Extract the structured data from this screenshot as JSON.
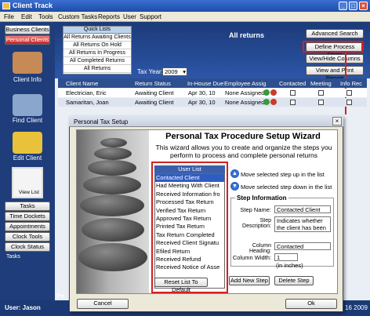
{
  "window": {
    "title": "Client Track"
  },
  "menu": [
    "File",
    "Edit",
    "Tools",
    "Custom Tasks",
    "Reports",
    "User",
    "Support"
  ],
  "sidebar": {
    "top_buttons": [
      "Business Clients",
      "Personal Clients"
    ],
    "nav": [
      {
        "label": "Client Info",
        "icon": "handshake-icon"
      },
      {
        "label": "Find Client",
        "icon": "magnifier-icon"
      },
      {
        "label": "Edit Client",
        "icon": "pencil-icon"
      },
      {
        "label": "View List",
        "icon": "list-icon"
      }
    ],
    "bottom_buttons": [
      "Tasks",
      "Time Dockets",
      "Appointments",
      "Clock Tools",
      "Clock Status"
    ],
    "tasks_label": "Tasks"
  },
  "quick_lists": {
    "header": "Quick Lists",
    "items": [
      "All Returns Awaiting Clients",
      "All Returns On Hold",
      "All Returns In Progress",
      "All Completed Returns",
      "All Returns"
    ]
  },
  "heading": "All returns",
  "tax_year": {
    "label": "Tax Year:",
    "value": "2009"
  },
  "right_buttons": [
    "Advanced Search",
    "Define Process Steps",
    "View/Hide Columns",
    "View and Print Report"
  ],
  "table": {
    "columns": [
      "Client Name",
      "Return Status",
      "In-House Due",
      "Employee Assig",
      "Contacted",
      "Meeting",
      "Info Rec"
    ],
    "rows": [
      {
        "name": "Electrician, Eric",
        "status": "Awaiting Client",
        "due": "Apr 30, 10",
        "employee": "None Assigned"
      },
      {
        "name": "Samaritan, Joan",
        "status": "Awaiting Client",
        "due": "Apr 30, 10",
        "employee": "None Assigned"
      }
    ]
  },
  "status": {
    "user": "User: Jason",
    "date": "16 2009",
    "footer_text": "Pe"
  },
  "dialog": {
    "title": "Personal Tax Setup",
    "heading": "Personal Tax Procedure Setup Wizard",
    "description": "This wizard allows you to create and organize the steps you perform to process and complete personal returns",
    "user_list": {
      "header": "User List",
      "items": [
        "Contacted Client",
        "Had Meeting With Client",
        "Received Information fro",
        "Processed Tax Return",
        "Verified Tax Return",
        "Approved Tax Return",
        "Printed Tax Return",
        "Tax Return Completed",
        "Received Client Signatu",
        "Efiled Return",
        "Received Refund",
        "Received Notice of Asse"
      ],
      "selected": 0
    },
    "move_up": "Move selected step up in the list",
    "move_down": "Move selected step down in the list",
    "step_info": {
      "label": "Step Information",
      "step_name_label": "Step Name:",
      "step_name": "Contacted Client",
      "step_desc_label": "Step Description:",
      "step_desc": "Indicates whether the client has been",
      "col_heading_label": "Column Heading:",
      "col_heading": "Contacted",
      "col_width_label": "Column Width:",
      "col_width": "1",
      "col_width_unit": "(in inches)"
    },
    "reset_btn": "Reset List To Default",
    "add_btn": "Add New Step",
    "delete_btn": "Delete Step",
    "cancel_btn": "Cancel",
    "ok_btn": "Ok"
  }
}
